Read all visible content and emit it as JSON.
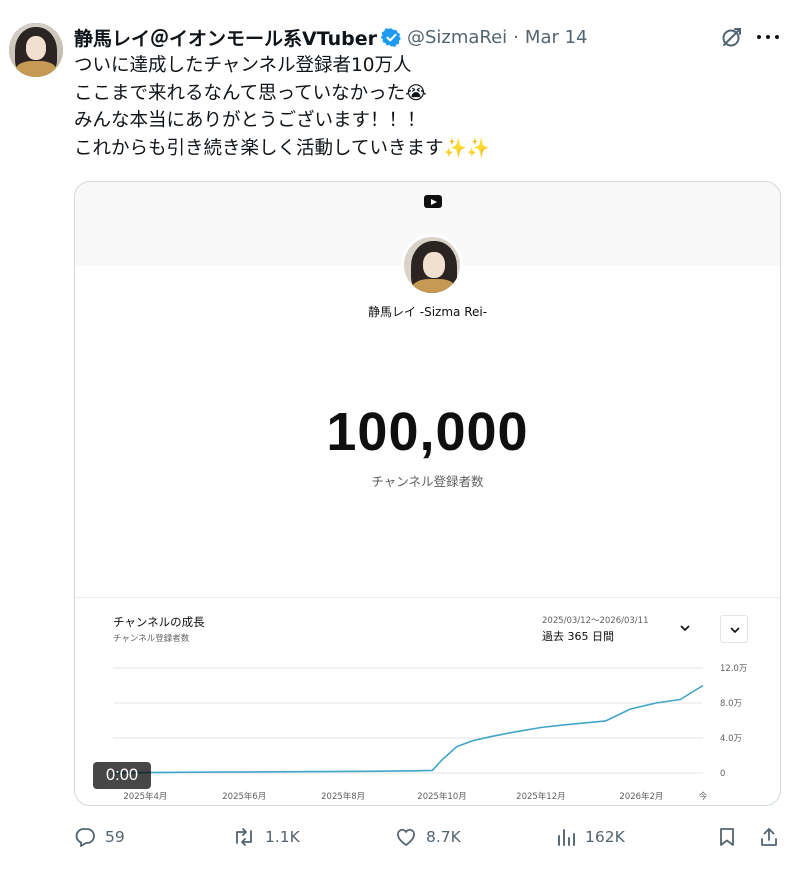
{
  "tweet": {
    "author_name": "静馬レイ＠イオンモール系VTuber",
    "handle": "@SizmaRei",
    "separator": "·",
    "date": "Mar 14",
    "text_lines": [
      "ついに達成したチャンネル登録者10万人",
      "ここまで来れるなんて思っていなかった😭",
      "みんな本当にありがとうございます！！！",
      "これからも引き続き楽しく活動していきます✨✨"
    ],
    "icons": {
      "verified": "verified-badge-icon",
      "grok": "grok-icon",
      "more": "more-icon"
    },
    "colors": {
      "verified": "#1d9bf0",
      "secondary_text": "#536471",
      "chart_line": "#41a5c7"
    }
  },
  "media": {
    "platform_icon": "youtube-icon",
    "channel_name": "静馬レイ -Sizma Rei-",
    "subscriber_count": "100,000",
    "subscriber_label": "チャンネル登録者数",
    "growth_title": "チャンネルの成長",
    "growth_subtitle": "チャンネル登録者数",
    "date_range": "2025/03/12〜2026/03/11",
    "period_label": "過去 365 日間",
    "video_timestamp": "0:00"
  },
  "chart_data": {
    "type": "line",
    "title": "チャンネルの成長",
    "subtitle": "チャンネル登録者数",
    "x_tick_labels": [
      "2025年4月",
      "2025年6月",
      "2025年8月",
      "2025年10月",
      "2025年12月",
      "2026年2月",
      "今"
    ],
    "y_tick_labels": [
      "0",
      "4.0万",
      "8.0万",
      "12.0万"
    ],
    "ylim": [
      0,
      120000
    ],
    "grid": true,
    "series": [
      {
        "x": [
          "2025-03-12",
          "2025-04-01",
          "2025-05-15",
          "2025-07-01",
          "2025-08-15",
          "2025-09-15",
          "2025-09-25",
          "2025-10-01",
          "2025-10-10",
          "2025-10-20",
          "2025-11-01",
          "2025-11-15",
          "2025-12-01",
          "2025-12-15",
          "2026-01-01",
          "2026-01-10",
          "2026-01-15",
          "2026-01-25",
          "2026-02-10",
          "2026-02-25",
          "2026-03-11"
        ],
        "y": [
          0,
          500,
          1000,
          1500,
          2000,
          2500,
          3000,
          15000,
          30000,
          37000,
          42000,
          47000,
          52000,
          55000,
          58000,
          59500,
          64000,
          73000,
          80000,
          84000,
          100000
        ]
      }
    ]
  },
  "actions": {
    "replies": "59",
    "retweets": "1.1K",
    "likes": "8.7K",
    "views": "162K"
  }
}
